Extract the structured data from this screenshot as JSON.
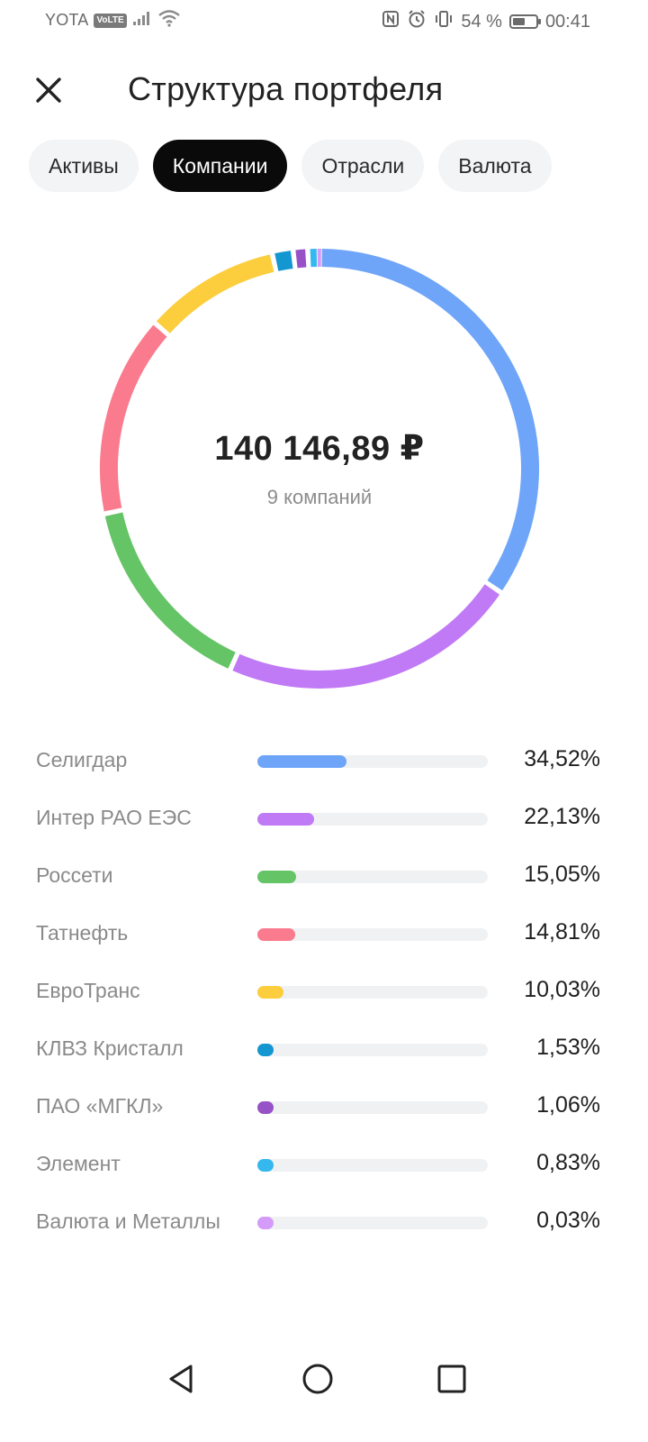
{
  "status_bar": {
    "carrier": "YOTA",
    "volte": "VoLTE",
    "battery_text": "54 %",
    "battery_level": 0.54,
    "time": "00:41"
  },
  "header": {
    "title": "Структура портфеля",
    "close_icon": "close-icon"
  },
  "tabs": [
    {
      "label": "Активы",
      "active": false
    },
    {
      "label": "Компании",
      "active": true
    },
    {
      "label": "Отрасли",
      "active": false
    },
    {
      "label": "Валюта",
      "active": false
    }
  ],
  "summary": {
    "total": "140 146,89 ₽",
    "count_label": "9 компаний"
  },
  "chart_data": {
    "type": "pie",
    "categories": [
      "Селигдар",
      "Интер РАО ЕЭС",
      "Россети",
      "Татнефть",
      "ЕвроТранс",
      "КЛВЗ Кристалл",
      "ПАО «МГКЛ»",
      "Элемент",
      "Валюта и Металлы"
    ],
    "values": [
      34.52,
      22.13,
      15.05,
      14.81,
      10.03,
      1.53,
      1.06,
      0.83,
      0.03
    ],
    "colors": [
      "#6fa5f8",
      "#c07af5",
      "#64c466",
      "#fb7b8e",
      "#fccd3d",
      "#1497d1",
      "#9652c6",
      "#35b8ee",
      "#d49cf8"
    ],
    "labels": [
      "34,52%",
      "22,13%",
      "15,05%",
      "14,81%",
      "10,03%",
      "1,53%",
      "1,06%",
      "0,83%",
      "0,03%"
    ]
  },
  "navbar": {
    "back_icon": "back-triangle-icon",
    "home_icon": "home-circle-icon",
    "recents_icon": "recents-square-icon"
  }
}
